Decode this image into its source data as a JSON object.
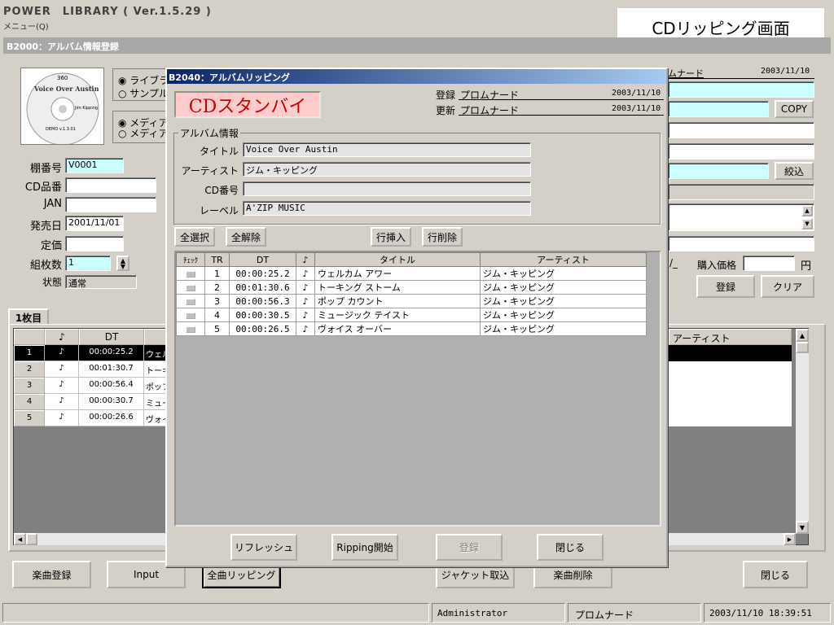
{
  "app": {
    "title": "POWER　LIBRARY ( Ver.1.5.29 )",
    "menu": "メニュー(Q)"
  },
  "caption": "CDリッピング画面",
  "main": {
    "title": "B2000：アルバム情報登録",
    "radio_lib": "ライブラ",
    "radio_sample": "サンプル",
    "radio_media1": "メディア",
    "radio_media2": "メディア",
    "labels": {
      "shelf": "棚番号",
      "cd": "CD品番",
      "jan": "JAN",
      "release": "発売日",
      "price": "定価",
      "discs": "組枚数",
      "status": "状態"
    },
    "values": {
      "shelf": "V0001",
      "release": "2001/11/01",
      "discs": "1",
      "status": "通常"
    },
    "top_reg_name": "ムナード",
    "top_reg_date": "2003/11/10",
    "copy_btn": "COPY",
    "narrow_btn": "絞込",
    "purchase_label": "購入価格",
    "yen": "円",
    "date_stub": "/_",
    "register_btn": "登録",
    "clear_btn": "クリア",
    "tab": "1枚目",
    "cols": {
      "note": "♪",
      "dt": "DT",
      "artist": "アーティスト"
    },
    "rows": [
      {
        "n": "1",
        "note": "♪",
        "dt": "00:00:25.2",
        "t": "ウェル"
      },
      {
        "n": "2",
        "note": "♪",
        "dt": "00:01:30.7",
        "t": "トーキ"
      },
      {
        "n": "3",
        "note": "♪",
        "dt": "00:00:56.4",
        "t": "ポッフ"
      },
      {
        "n": "4",
        "note": "♪",
        "dt": "00:00:30.7",
        "t": "ミュー"
      },
      {
        "n": "5",
        "note": "♪",
        "dt": "00:00:26.6",
        "t": "ヴォイ"
      }
    ],
    "bottom": {
      "song_reg": "楽曲登録",
      "input": "Input",
      "all_rip": "全曲リッピング",
      "jacket": "ジャケット取込",
      "delete": "楽曲削除",
      "close": "閉じる"
    }
  },
  "cd_art": {
    "num": "360",
    "title": "Voice Over Austin",
    "artist": "Jim Kipping",
    "demo": "DEMO v.1.3.01"
  },
  "dialog": {
    "title": "B2040：アルバムリッピング",
    "status": "CDスタンバイ",
    "reg_label": "登録",
    "reg_name": "プロムナード",
    "reg_date": "2003/11/10",
    "upd_label": "更新",
    "upd_name": "プロムナード",
    "upd_date": "2003/11/10",
    "group": "アルバム情報",
    "labels": {
      "title": "タイトル",
      "artist": "アーティスト",
      "cdno": "CD番号",
      "label": "レーベル"
    },
    "values": {
      "title": "Voice Over Austin",
      "artist": "ジム・キッピング",
      "cdno": "",
      "label": "A'ZIP MUSIC"
    },
    "btn_all": "全選択",
    "btn_clear": "全解除",
    "btn_insert": "行挿入",
    "btn_delrow": "行削除",
    "cols": {
      "check": "ﾁｪｯｸ",
      "tr": "TR",
      "dt": "DT",
      "note": "♪",
      "title": "タイトル",
      "artist": "アーティスト"
    },
    "rows": [
      {
        "tr": "1",
        "dt": "00:00:25.2",
        "note": "♪",
        "title": "ウェルカム アワー",
        "artist": "ジム・キッピング"
      },
      {
        "tr": "2",
        "dt": "00:01:30.6",
        "note": "♪",
        "title": "トーキング ストーム",
        "artist": "ジム・キッピング"
      },
      {
        "tr": "3",
        "dt": "00:00:56.3",
        "note": "♪",
        "title": "ポップ カウント",
        "artist": "ジム・キッピング"
      },
      {
        "tr": "4",
        "dt": "00:00:30.5",
        "note": "♪",
        "title": "ミュージック テイスト",
        "artist": "ジム・キッピング"
      },
      {
        "tr": "5",
        "dt": "00:00:26.5",
        "note": "♪",
        "title": "ヴォイス オーバー",
        "artist": "ジム・キッピング"
      }
    ],
    "btn_refresh": "リフレッシュ",
    "btn_rip": "Ripping開始",
    "btn_register": "登録",
    "btn_close": "閉じる"
  },
  "statusbar": {
    "user": "Administrator",
    "name": "プロムナード",
    "datetime": "2003/11/10 18:39:51"
  }
}
